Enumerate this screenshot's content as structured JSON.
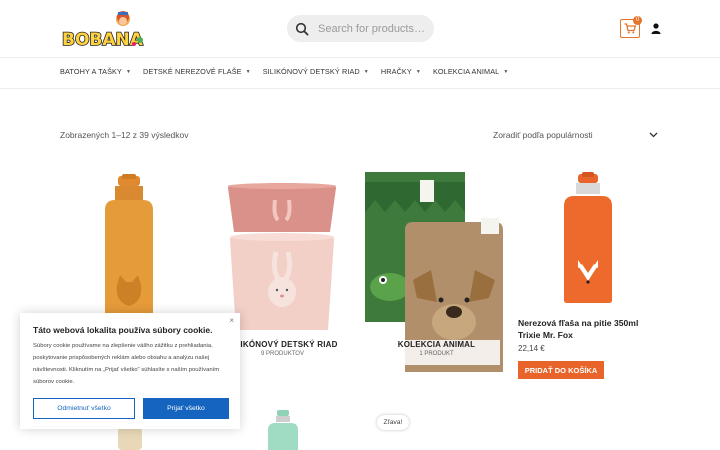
{
  "brand": {
    "logo_text": "BOBANA"
  },
  "search": {
    "placeholder": "Search for products…"
  },
  "cart": {
    "count": "0"
  },
  "nav": {
    "items": [
      {
        "label": "BATOHY A TAŠKY"
      },
      {
        "label": "DETSKÉ NEREZOVÉ FLAŠE"
      },
      {
        "label": "SILIKÓNOVÝ DETSKÝ RIAD"
      },
      {
        "label": "HRAČKY"
      },
      {
        "label": "KOLEKCIA ANIMAL"
      }
    ]
  },
  "shop": {
    "result_count": "Zobrazených 1–12 z 39 výsledkov",
    "ordering": "Zoradiť podľa populárnosti"
  },
  "categories": [
    {
      "title": "SILIKÓNOVÝ DETSKÝ RIAD",
      "count": "9 PRODUKTOV"
    },
    {
      "title": "KOLEKCIA ANIMAL",
      "count": "1 PRODUKT"
    }
  ],
  "product": {
    "title": "Nerezová fľaša na pitie 350ml Trixie Mr. Fox",
    "price": "22,14 €",
    "add_to_cart": "Pridať do košíka"
  },
  "sale_badge": "Zľava!",
  "cookie": {
    "title": "Táto webová lokalita používa súbory cookie.",
    "text": "Súbory cookie používame na zlepšenie vášho zážitku z prehliadania, poskytovanie prispôsobených reklám alebo obsahu a analýzu našej návštevnosti. Kliknutím na „Prijať všetko“ súhlasíte s naším používaním súborov cookie.",
    "reject": "Odmietnuť všetko",
    "accept": "Prijať všetko",
    "close": "×"
  },
  "colors": {
    "accent": "#e8732a",
    "button_orange": "#e8642a",
    "cookie_blue": "#1565c0"
  }
}
